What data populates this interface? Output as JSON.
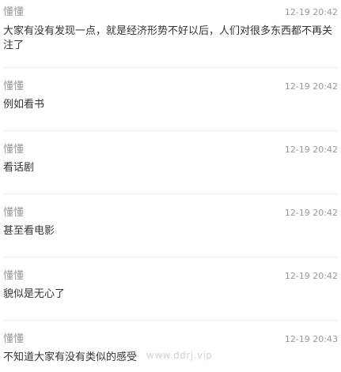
{
  "comments": [
    {
      "name": "懂懂",
      "time": "12-19 20:42",
      "text": "大家有没有发现一点，就是经济形势不好以后，人们对很多东西都不再关注了"
    },
    {
      "name": "懂懂",
      "time": "12-19 20:42",
      "text": "例如看书"
    },
    {
      "name": "懂懂",
      "time": "12-19 20:42",
      "text": "看话剧"
    },
    {
      "name": "懂懂",
      "time": "12-19 20:42",
      "text": "甚至看电影"
    },
    {
      "name": "懂懂",
      "time": "12-19 20:42",
      "text": "貌似是无心了"
    },
    {
      "name": "懂懂",
      "time": "12-19 20:43",
      "text": "不知道大家有没有类似的感受"
    }
  ],
  "watermark": "www.ddrj.vip"
}
